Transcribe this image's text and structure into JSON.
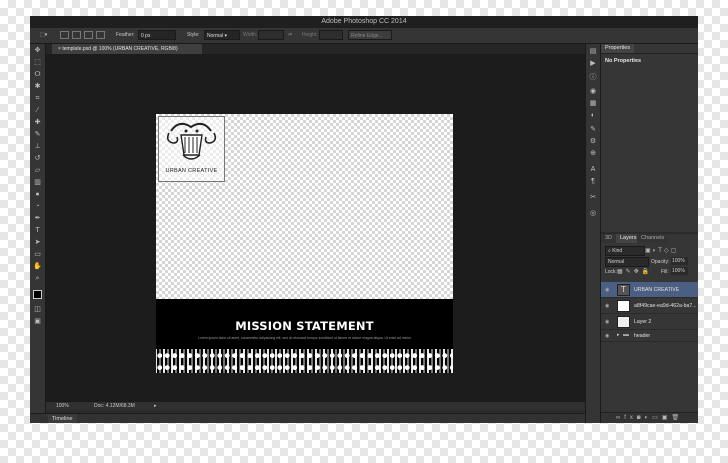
{
  "app": {
    "title": "Adobe Photoshop CC 2014"
  },
  "options_bar": {
    "feather_label": "Feather:",
    "feather_value": "0 px",
    "style_label": "Style:",
    "style_value": "Normal",
    "width_label": "Width:",
    "height_label": "Height:",
    "refine_edge_label": "Refine Edge..."
  },
  "document": {
    "tab_label": "template.psd @ 100% (URBAN CREATIVE, RGB/8)",
    "logo_text": "URBAN CREATIVE",
    "heading": "MISSION STATEMENT",
    "body_text": "Lorem ipsum dolor sit amet, consectetur adipisicing elit, sed do eiusmod tempor incididunt ut labore et dolore magna aliqua. Ut enim ad minim",
    "zoom": "100%",
    "doc_size": "Doc: 4.12M/68.3M"
  },
  "timeline": {
    "label": "Timeline"
  },
  "properties": {
    "tab_label": "Properties",
    "empty_text": "No Properties"
  },
  "layers_panel": {
    "tabs": [
      "3D",
      "Layers",
      "Channels"
    ],
    "filter_label": "Kind",
    "blend_mode": "Normal",
    "opacity_label": "Opacity:",
    "opacity_value": "100%",
    "lock_label": "Lock:",
    "fill_label": "Fill:",
    "fill_value": "100%",
    "layers": [
      {
        "name": "URBAN CREATIVE",
        "kind": "text",
        "selected": true
      },
      {
        "name": "a8f49cae-ea9d-462a-ba7...",
        "kind": "image",
        "selected": false
      },
      {
        "name": "Layer 2",
        "kind": "image",
        "selected": false
      },
      {
        "name": "header",
        "kind": "group",
        "selected": false
      }
    ]
  },
  "colors": {
    "accent_selected": "#4a5f82",
    "window_bg": "#2b2b2b",
    "canvas_bottom": "#000000"
  },
  "icons": [
    "marquee-icon",
    "move-icon",
    "lasso-icon",
    "quick-select-icon",
    "crop-icon",
    "eyedropper-icon",
    "spot-heal-icon",
    "brush-icon",
    "clone-stamp-icon",
    "history-brush-icon",
    "eraser-icon",
    "gradient-icon",
    "blur-icon",
    "dodge-icon",
    "pen-icon",
    "type-icon",
    "path-select-icon",
    "shape-icon",
    "hand-icon",
    "zoom-icon"
  ]
}
